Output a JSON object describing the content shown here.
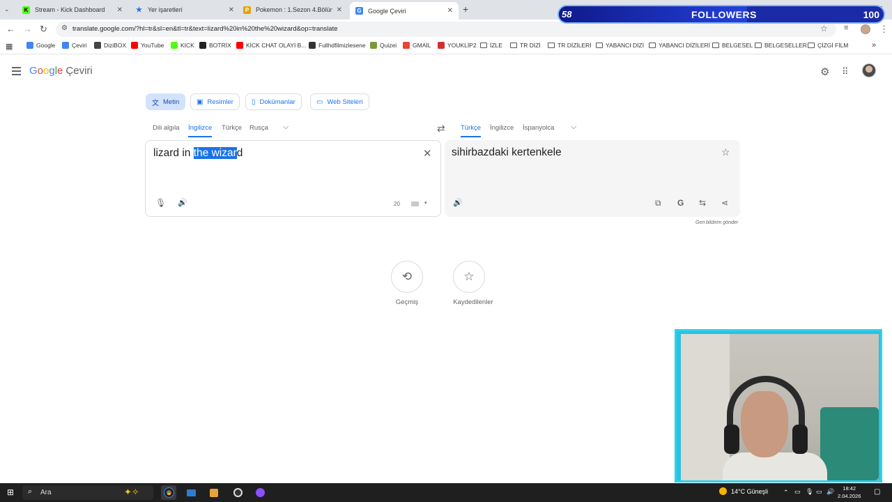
{
  "browser": {
    "tabs": [
      {
        "title": "Stream - Kick Dashboard",
        "favicon_color": "#53fc18",
        "favicon_text": "K"
      },
      {
        "title": "Yer işaretleri",
        "favicon_color": "#1a73e8",
        "favicon_text": "★"
      },
      {
        "title": "Pokemon : 1.Sezon 4.Bölüm - Ç",
        "favicon_color": "#e0a400",
        "favicon_text": "P"
      },
      {
        "title": "Google Çeviri",
        "favicon_color": "#4285f4",
        "favicon_text": "G"
      }
    ],
    "url": "translate.google.com/?hl=tr&sl=en&tl=tr&text=lizard%20in%20the%20wizard&op=translate",
    "bookmarks": [
      {
        "label": "Google",
        "color": "#4285f4"
      },
      {
        "label": "Çeviri",
        "color": "#4285f4"
      },
      {
        "label": "DiziBOX",
        "color": "#444444"
      },
      {
        "label": "YouTube",
        "color": "#ff0000"
      },
      {
        "label": "KICK",
        "color": "#53fc18"
      },
      {
        "label": "BOTRİX",
        "color": "#222222"
      },
      {
        "label": "KİCK CHAT OLAYI B...",
        "color": "#ff0000"
      },
      {
        "label": "Fullhdfilmizlesene",
        "color": "#333333"
      },
      {
        "label": "Quizei",
        "color": "#7a9a3a"
      },
      {
        "label": "GMAİL",
        "color": "#ea4335"
      },
      {
        "label": "YOUKLİP2",
        "color": "#d32f2f"
      },
      {
        "label": "İZLE",
        "folder": true
      },
      {
        "label": "TR DİZİ",
        "folder": true
      },
      {
        "label": "TR DİZİLERİ",
        "folder": true
      },
      {
        "label": "YABANCI DİZİ",
        "folder": true
      },
      {
        "label": "YABANCI DİZİLERİ",
        "folder": true
      },
      {
        "label": "BELGESEL",
        "folder": true
      },
      {
        "label": "BELGESELLER",
        "folder": true
      },
      {
        "label": "ÇİZGİ FİLM",
        "folder": true
      }
    ]
  },
  "app": {
    "logo": {
      "g1": "G",
      "g2": "o",
      "g3": "o",
      "g4": "g",
      "g5": "l",
      "g6": "e"
    },
    "service_name": "Çeviri",
    "modes": [
      "Metin",
      "Resimler",
      "Dokümanlar",
      "Web Siteleri"
    ],
    "source_langs": [
      "Dili algıla",
      "İngilizce",
      "Türkçe",
      "Rusça"
    ],
    "target_langs": [
      "Türkçe",
      "İngilizce",
      "İspanyolca"
    ],
    "source_text_plain": "lizard in ",
    "source_text_selected": "the wizar",
    "source_text_tail": "d",
    "char_count": "20",
    "translation": "sihirbazdaki kertenkele",
    "feedback": "Geri bildirim gönder",
    "history_label": "Geçmiş",
    "saved_label": "Kaydedilenler"
  },
  "overlay": {
    "followers_current": "58",
    "followers_label": "FOLLOWERS",
    "followers_goal": "100",
    "followers_progress": 0.58
  },
  "taskbar": {
    "search_placeholder": "Ara",
    "weather": "14°C  Güneşli",
    "time": "18:42",
    "date": "2.04.2026"
  },
  "colors": {
    "accent": "#1a73e8",
    "selection": "#1a73e8",
    "overlay_blue": "#1b2aa6",
    "webcam_frame": "#2bd2f0"
  }
}
